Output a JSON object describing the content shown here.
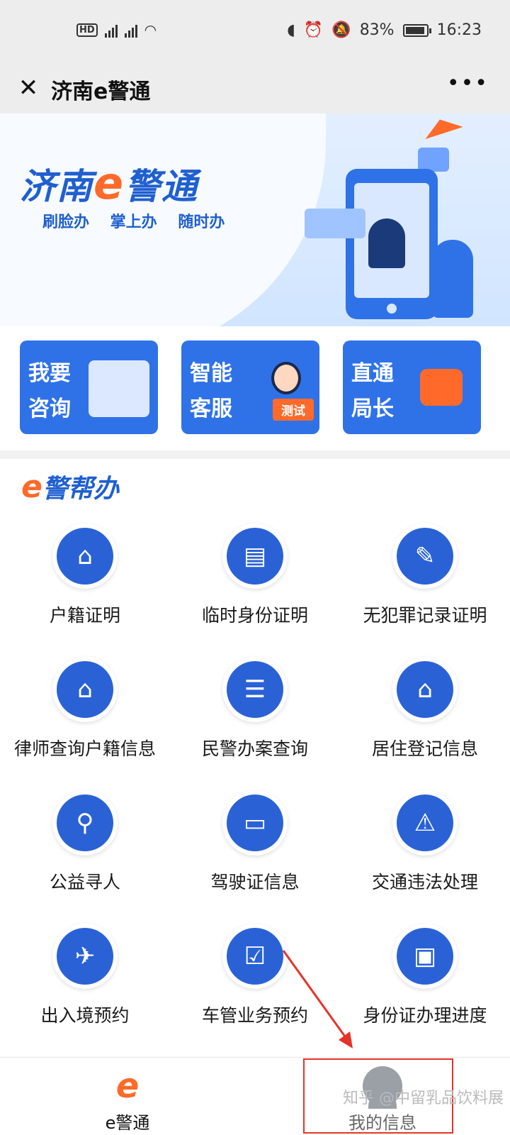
{
  "status_bar": {
    "network": "HD 4G 4G",
    "battery": "83%",
    "time": "16:23"
  },
  "titlebar": {
    "title": "济南e警通",
    "close_icon": "close-icon",
    "more_icon": "more-icon"
  },
  "banner": {
    "logo_prefix": "济南",
    "logo_e": "e",
    "logo_suffix": "警通",
    "slogan": "刷脸办 掌上办 随时办"
  },
  "quick_cards": [
    {
      "label": "我要咨询",
      "icon": "consult-icon"
    },
    {
      "label": "智能客服",
      "tag": "测试",
      "icon": "service-agent-icon"
    },
    {
      "label": "直通局长",
      "icon": "mailbox-icon"
    }
  ],
  "section": {
    "logo_e": "e",
    "title": "警帮办"
  },
  "services": [
    {
      "label": "户籍证明",
      "icon": "household-icon"
    },
    {
      "label": "临时身份证明",
      "icon": "temp-id-icon"
    },
    {
      "label": "无犯罪记录证明",
      "icon": "no-crime-record-icon"
    },
    {
      "label": "律师查询户籍信息",
      "icon": "lawyer-query-icon"
    },
    {
      "label": "民警办案查询",
      "icon": "case-query-icon"
    },
    {
      "label": "居住登记信息",
      "icon": "residence-icon"
    },
    {
      "label": "公益寻人",
      "icon": "search-people-icon"
    },
    {
      "label": "驾驶证信息",
      "icon": "driver-license-icon"
    },
    {
      "label": "交通违法处理",
      "icon": "traffic-violation-icon"
    },
    {
      "label": "出入境预约",
      "icon": "immigration-icon"
    },
    {
      "label": "车管业务预约",
      "icon": "vehicle-appointment-icon"
    },
    {
      "label": "身份证办理进度",
      "icon": "id-progress-icon"
    }
  ],
  "tabbar": [
    {
      "label": "e警通",
      "icon": "e-logo-icon"
    },
    {
      "label": "我的信息",
      "icon": "user-icon"
    }
  ],
  "watermark": "知乎 @中留乳品饮料展",
  "colors": {
    "primary": "#2f72e8",
    "accent": "#ff6a2a",
    "annotation": "#e5342a"
  }
}
